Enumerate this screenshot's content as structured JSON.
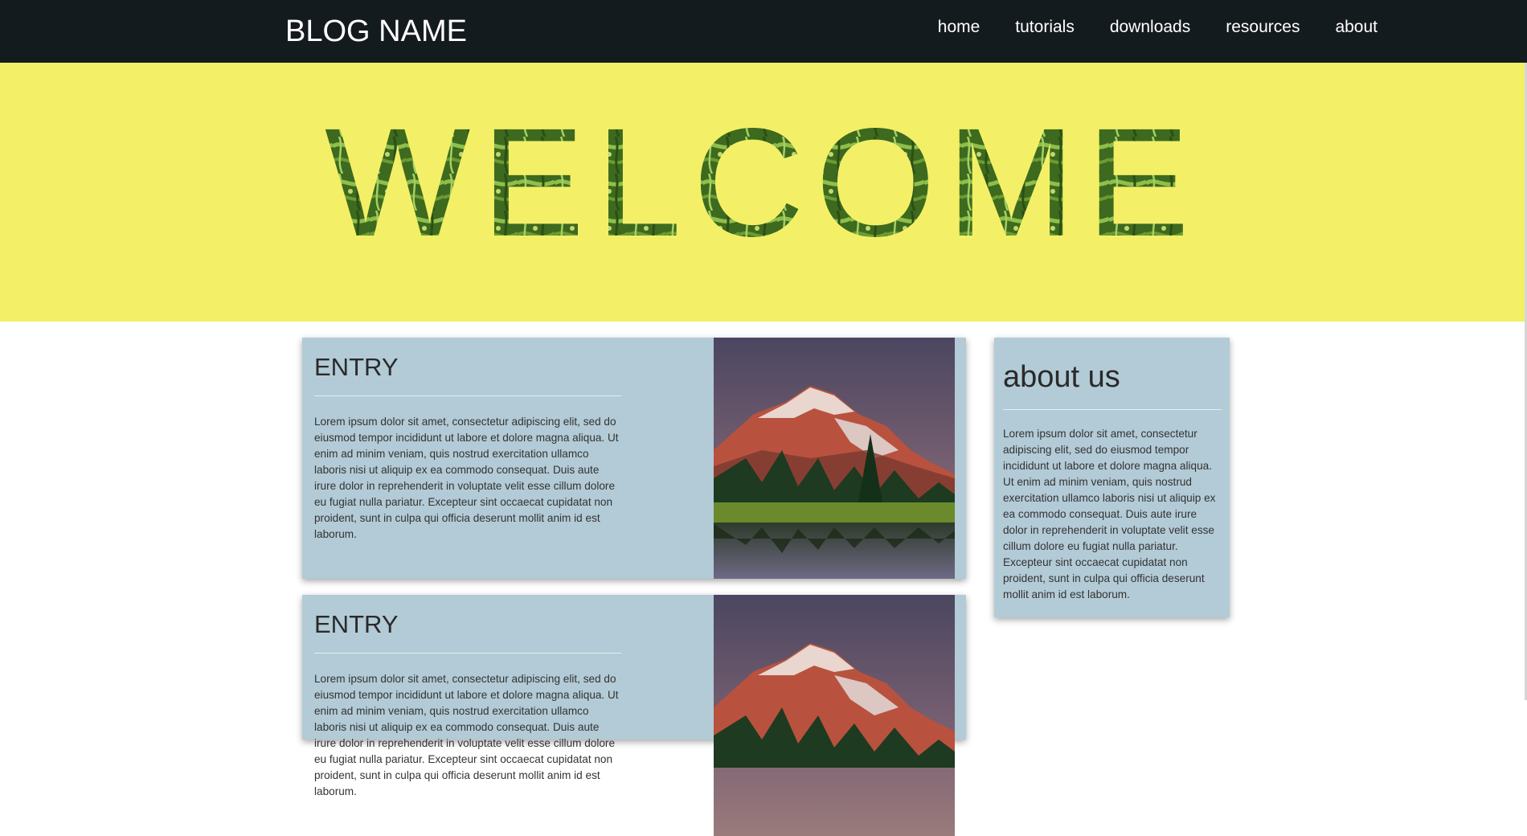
{
  "header": {
    "brand": "BLOG NAME",
    "nav": [
      "home",
      "tutorials",
      "downloads",
      "resources",
      "about"
    ]
  },
  "hero": {
    "title": "WELCOME"
  },
  "entries": [
    {
      "title": "ENTRY",
      "body": "Lorem ipsum dolor sit amet, consectetur adipiscing elit, sed do eiusmod tempor incididunt ut labore et dolore magna aliqua. Ut enim ad minim veniam, quis nostrud exercitation ullamco laboris nisi ut aliquip ex ea commodo consequat. Duis aute irure dolor in reprehenderit in voluptate velit esse cillum dolore eu fugiat nulla pariatur. Excepteur sint occaecat cupidatat non proident, sunt in culpa qui officia deserunt mollit anim id est laborum.",
      "image": "mountain-lake-photo"
    },
    {
      "title": "ENTRY",
      "body": "Lorem ipsum dolor sit amet, consectetur adipiscing elit, sed do eiusmod tempor incididunt ut labore et dolore magna aliqua. Ut enim ad minim veniam, quis nostrud exercitation ullamco laboris nisi ut aliquip ex ea commodo consequat. Duis aute irure dolor in reprehenderit in voluptate velit esse cillum dolore eu fugiat nulla pariatur. Excepteur sint occaecat cupidatat non proident, sunt in culpa qui officia deserunt mollit anim id est laborum.",
      "image": "mountain-lake-photo"
    }
  ],
  "sidebar": {
    "title": "about us",
    "body": "Lorem ipsum dolor sit amet, consectetur adipiscing elit, sed do eiusmod tempor incididunt ut labore et dolore magna aliqua. Ut enim ad minim veniam, quis nostrud exercitation ullamco laboris nisi ut aliquip ex ea commodo consequat. Duis aute irure dolor in reprehenderit in voluptate velit esse cillum dolore eu fugiat nulla pariatur. Excepteur sint occaecat cupidatat non proident, sunt in culpa qui officia deserunt mollit anim id est laborum."
  },
  "colors": {
    "navbar": "#141b1f",
    "hero": "#f3f067",
    "card": "#b2cbd6",
    "leaf_green": "#3f6a1f"
  }
}
